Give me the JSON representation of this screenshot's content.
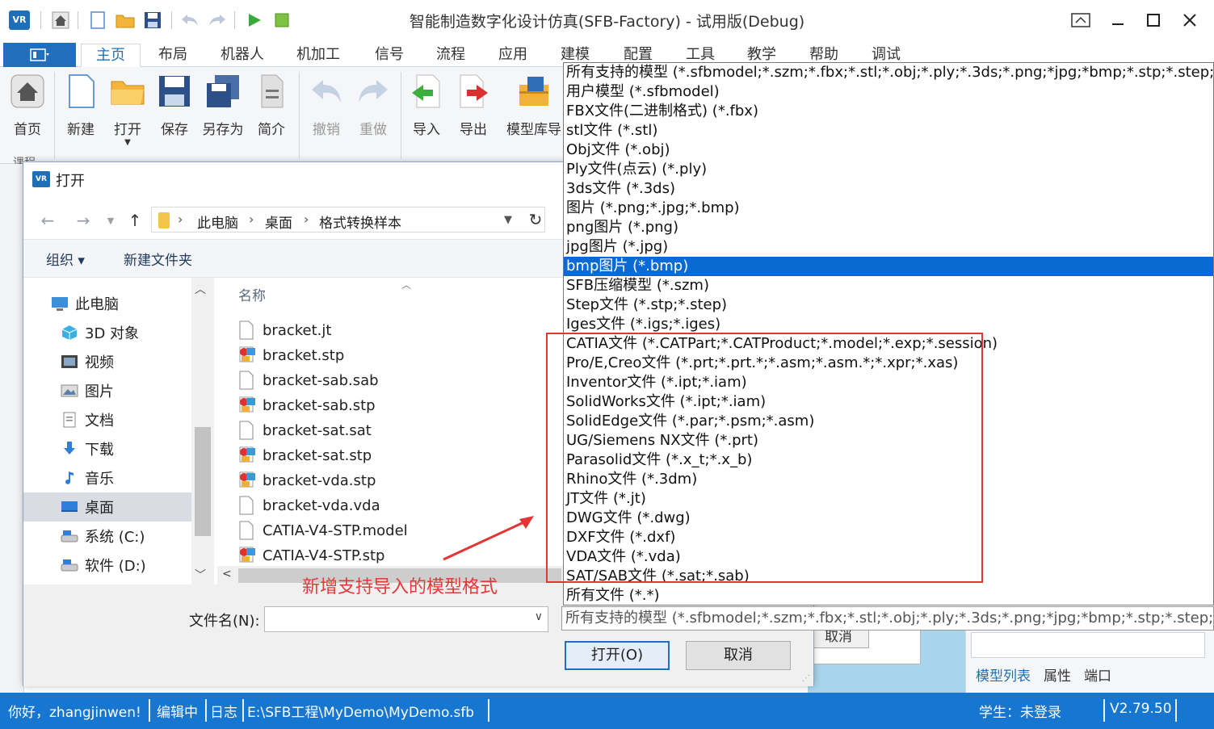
{
  "app": {
    "logo_text": "VR",
    "title": "智能制造数字化设计仿真(SFB-Factory) - 试用版(Debug)"
  },
  "ribbon": {
    "tabs": [
      "主页",
      "布局",
      "机器人",
      "机加工",
      "信号",
      "流程",
      "应用",
      "建模",
      "配置",
      "工具",
      "教学",
      "帮助",
      "调试"
    ],
    "buttons": {
      "home": "首页",
      "new": "新建",
      "open": "打开",
      "save": "保存",
      "save_as": "另存为",
      "brief": "简介",
      "undo": "撤销",
      "redo": "重做",
      "import": "导入",
      "export": "导出",
      "model_lib": "模型库导"
    },
    "group_labels": {
      "course": "课程"
    }
  },
  "dialog": {
    "title": "打开",
    "breadcrumb": [
      "此电脑",
      "桌面",
      "格式转换样本"
    ],
    "toolbar": {
      "organize": "组织 ▾",
      "new_folder": "新建文件夹"
    },
    "nav_items": [
      {
        "label": "此电脑",
        "icon": "computer-icon"
      },
      {
        "label": "3D 对象",
        "icon": "cube-icon"
      },
      {
        "label": "视频",
        "icon": "video-icon"
      },
      {
        "label": "图片",
        "icon": "picture-icon"
      },
      {
        "label": "文档",
        "icon": "document-icon"
      },
      {
        "label": "下载",
        "icon": "download-icon"
      },
      {
        "label": "音乐",
        "icon": "music-icon"
      },
      {
        "label": "桌面",
        "icon": "desktop-icon",
        "selected": true
      },
      {
        "label": "系统 (C:)",
        "icon": "drive-icon"
      },
      {
        "label": "软件 (D:)",
        "icon": "drive-icon"
      }
    ],
    "column_header": "名称",
    "files": [
      {
        "name": "bracket.jt",
        "type": "blank"
      },
      {
        "name": "bracket.stp",
        "type": "3d"
      },
      {
        "name": "bracket-sab.sab",
        "type": "blank"
      },
      {
        "name": "bracket-sab.stp",
        "type": "3d"
      },
      {
        "name": "bracket-sat.sat",
        "type": "blank"
      },
      {
        "name": "bracket-sat.stp",
        "type": "3d"
      },
      {
        "name": "bracket-vda.stp",
        "type": "3d"
      },
      {
        "name": "bracket-vda.vda",
        "type": "blank"
      },
      {
        "name": "CATIA-V4-STP.model",
        "type": "blank"
      },
      {
        "name": "CATIA-V4-STP.stp",
        "type": "3d"
      }
    ],
    "filename_label": "文件名(N):",
    "filename_value": "",
    "open_button": "打开(O)",
    "cancel_button": "取消"
  },
  "filter": {
    "options": [
      "所有支持的模型 (*.sfbmodel;*.szm;*.fbx;*.stl;*.obj;*.ply;*.3ds;*.png;*jpg;*bmp;*.stp;*.step;*.igs;*.iges;*.CATPart;*.CATProduct;*.model;*.exp;*.session;*.prt;*.asm;*.ipt;*.iam;*.par;*.psm;*.x_t;*.x_b;*.3dm;*.jt;*.dwg;*.dxf;*.vda;*.sat;*.sab)",
      "用户模型 (*.sfbmodel)",
      "FBX文件(二进制格式) (*.fbx)",
      "stl文件 (*.stl)",
      "Obj文件 (*.obj)",
      "Ply文件(点云) (*.ply)",
      "3ds文件 (*.3ds)",
      "图片 (*.png;*.jpg;*.bmp)",
      "png图片 (*.png)",
      "jpg图片 (*.jpg)",
      "bmp图片 (*.bmp)",
      "SFB压缩模型 (*.szm)",
      "Step文件 (*.stp;*.step)",
      "Iges文件 (*.igs;*.iges)",
      "CATIA文件 (*.CATPart;*.CATProduct;*.model;*.exp;*.session)",
      "Pro/E,Creo文件 (*.prt;*.prt.*;*.asm;*.asm.*;*.xpr;*.xas)",
      "Inventor文件 (*.ipt;*.iam)",
      "SolidWorks文件 (*.ipt;*.iam)",
      "SolidEdge文件 (*.par;*.psm;*.asm)",
      "UG/Siemens NX文件 (*.prt)",
      "Parasolid文件 (*.x_t;*.x_b)",
      "Rhino文件 (*.3dm)",
      "JT文件 (*.jt)",
      "DWG文件 (*.dwg)",
      "DXF文件 (*.dxf)",
      "VDA文件 (*.vda)",
      "SAT/SAB文件 (*.sat;*.sab)",
      "所有文件 (*.*)"
    ],
    "selected_index": 10,
    "combo_value": "所有支持的模型 (*.sfbmodel;*.szm;*.fbx;*.stl;*.obj;*.ply;*.3ds;*.png;*jpg;*bmp;*.stp;*.step;*.igs;*.iges;*.CATPart)"
  },
  "annotation": {
    "text": "新增支持导入的模型格式",
    "color": "#e43434"
  },
  "background": {
    "cancel_label": "取消",
    "right_tabs": [
      "模型列表",
      "属性",
      "端口"
    ]
  },
  "status": {
    "greeting": "你好，zhangjinwen!",
    "mode": "编辑中",
    "log": "日志",
    "path": "E:\\SFB工程\\MyDemo\\MyDemo.sfb",
    "user": "学生：未登录",
    "version": "V2.79.50"
  },
  "colors": {
    "accent": "#1776cf",
    "selection": "#0a6ad4",
    "highlight": "#e43434"
  }
}
